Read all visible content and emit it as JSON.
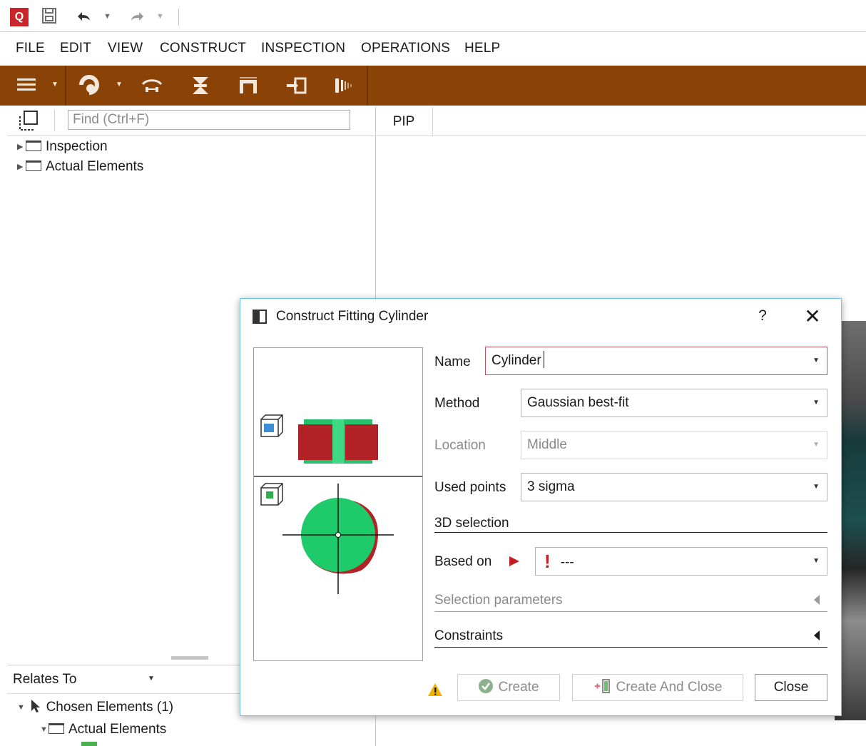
{
  "quick_access": {
    "app_logo": "Q",
    "save_icon": "save-icon",
    "undo_icon": "undo-icon",
    "redo_icon": "redo-icon"
  },
  "menu": {
    "items": [
      "FILE",
      "EDIT",
      "VIEW",
      "CONSTRUCT",
      "INSPECTION",
      "OPERATIONS",
      "HELP"
    ]
  },
  "toolbar": {
    "accent_color": "#8b4207",
    "icons": [
      "hamburger-icon",
      "cylinder-construct-icon",
      "connect-icon",
      "intersection-icon",
      "bridge-icon",
      "import-icon",
      "points-icon"
    ]
  },
  "explorer": {
    "search_placeholder": "Find (Ctrl+F)",
    "tree": [
      {
        "label": "Inspection"
      },
      {
        "label": "Actual Elements"
      }
    ],
    "relates_to_label": "Relates To",
    "chosen_elements_label": "Chosen Elements (1)",
    "chosen_child_label": "Actual Elements"
  },
  "viewport": {
    "tab_label": "PIP"
  },
  "dialog": {
    "title": "Construct Fitting Cylinder",
    "help": "?",
    "close_glyph": "✕",
    "name_label": "Name",
    "name_value": "Cylinder",
    "method_label": "Method",
    "method_value": "Gaussian best-fit",
    "location_label": "Location",
    "location_value": "Middle",
    "used_points_label": "Used points",
    "used_points_value": "3 sigma",
    "selection_3d_label": "3D selection",
    "based_on_label": "Based on",
    "based_on_value": "---",
    "selection_params_label": "Selection parameters",
    "constraints_label": "Constraints",
    "create_label": "Create",
    "create_close_label": "Create And Close",
    "close_label": "Close",
    "warning_color": "#f0b400",
    "error_color": "#c41e24"
  }
}
